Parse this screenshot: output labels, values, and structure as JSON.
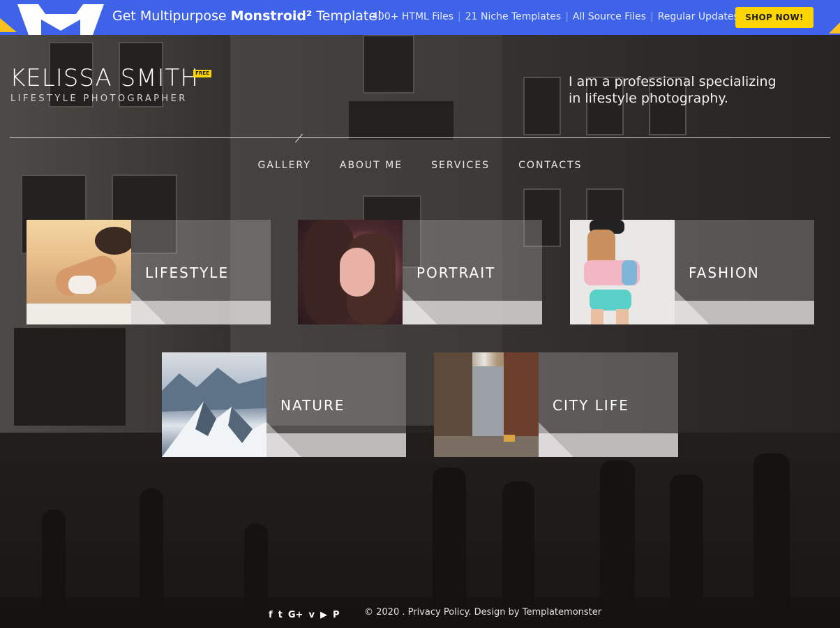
{
  "promo": {
    "title_prefix": "Get Multipurpose ",
    "title_brand": "Monstroid²",
    "title_suffix": " Template!",
    "links": [
      "400+ HTML Files",
      "21 Niche Templates",
      "All Source Files",
      "Regular Updates"
    ],
    "separator": "|",
    "cta": "SHOP NOW!",
    "colors": {
      "bar": "#3f63e8",
      "cta": "#ffd400"
    }
  },
  "header": {
    "name": "KELISSA SMITH",
    "badge": "FREE",
    "subtitle": "LIFESTYLE PHOTOGRAPHER",
    "tagline_line1": "I am a professional specializing",
    "tagline_line2": "in lifestyle photography."
  },
  "nav": {
    "items": [
      "GALLERY",
      "ABOUT ME",
      "SERVICES",
      "CONTACTS"
    ]
  },
  "gallery": {
    "tiles": [
      {
        "label": "LIFESTYLE"
      },
      {
        "label": "PORTRAIT"
      },
      {
        "label": "FASHION"
      },
      {
        "label": "NATURE"
      },
      {
        "label": "CITY LIFE"
      }
    ]
  },
  "footer": {
    "social_icons": [
      "facebook-icon",
      "twitter-icon",
      "google-plus-icon",
      "vimeo-icon",
      "youtube-icon",
      "pinterest-icon"
    ],
    "social_glyphs": [
      "f",
      "t",
      "G+",
      "v",
      "▶",
      "P"
    ],
    "copyright": "© 2020 . Privacy Policy. Design by Templatemonster"
  }
}
